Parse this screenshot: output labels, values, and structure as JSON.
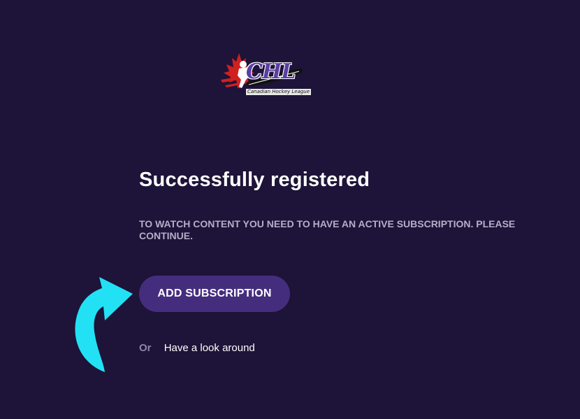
{
  "logo": {
    "wordmark": "CHL",
    "subtitle": "Canadian Hockey League",
    "icon": "chl-maple-leaf-logo"
  },
  "registration": {
    "title": "Successfully registered",
    "message": "TO WATCH CONTENT YOU NEED TO HAVE AN ACTIVE SUBSCRIPTION. PLEASE CONTINUE.",
    "cta_label": "ADD SUBSCRIPTION",
    "or_label": "Or",
    "browse_label": "Have a look around"
  },
  "annotation": {
    "icon": "curved-arrow-icon",
    "color": "#22e1f5"
  },
  "colors": {
    "background": "#1e1338",
    "button": "#452d7e",
    "muted_text": "#b5aec9"
  }
}
